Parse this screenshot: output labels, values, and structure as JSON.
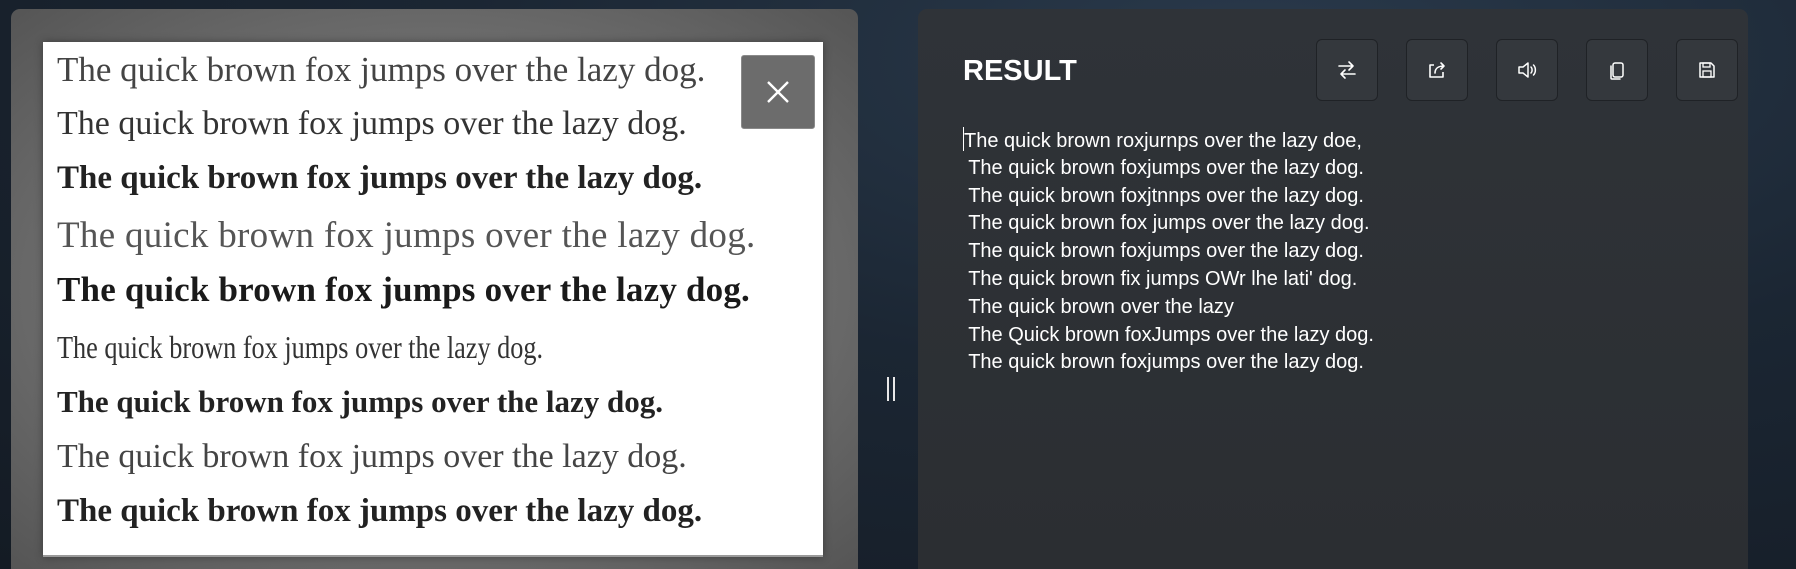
{
  "source_image": {
    "lines": [
      "The quick brown fox jumps over the lazy dog.",
      "The quick brown fox jumps over the lazy dog.",
      "The quick brown fox jumps over the lazy dog.",
      "The quick brown fox jumps over the lazy dog.",
      "The quick brown fox jumps over the lazy dog.",
      "The quick brown fox jumps over the lazy dog.",
      "The quick brown fox jumps over the lazy dog.",
      "The quick brown fox jumps over the lazy dog.",
      "The quick brown fox jumps over the lazy dog."
    ],
    "close_icon": "close-icon"
  },
  "splitter": {
    "icon": "splitter-grip-icon"
  },
  "result": {
    "title": "RESULT",
    "toolbar": [
      {
        "name": "swap",
        "icon": "swap-arrows-icon"
      },
      {
        "name": "share",
        "icon": "share-icon"
      },
      {
        "name": "read-aloud",
        "icon": "speaker-icon"
      },
      {
        "name": "copy",
        "icon": "copy-icon"
      },
      {
        "name": "save",
        "icon": "save-icon"
      }
    ],
    "lines": [
      "The quick brown roxjurnps over the lazy doe,",
      " The quick brown foxjumps over the lazy dog.",
      " The quick brown foxjtnnps over the lazy dog.",
      " The quick brown fox jumps over the lazy dog.",
      " The quick brown foxjumps over the lazy dog.",
      " The quick brown fix jumps OWr lhe lati' dog.",
      " The quick brown over the lazy",
      " The Quick brown foxJumps over the lazy dog.",
      " The quick brown foxjumps over the lazy dog."
    ]
  },
  "colors": {
    "pane_bg": "#2f3338",
    "button_bg": "#34383d",
    "text": "#ffffff"
  }
}
